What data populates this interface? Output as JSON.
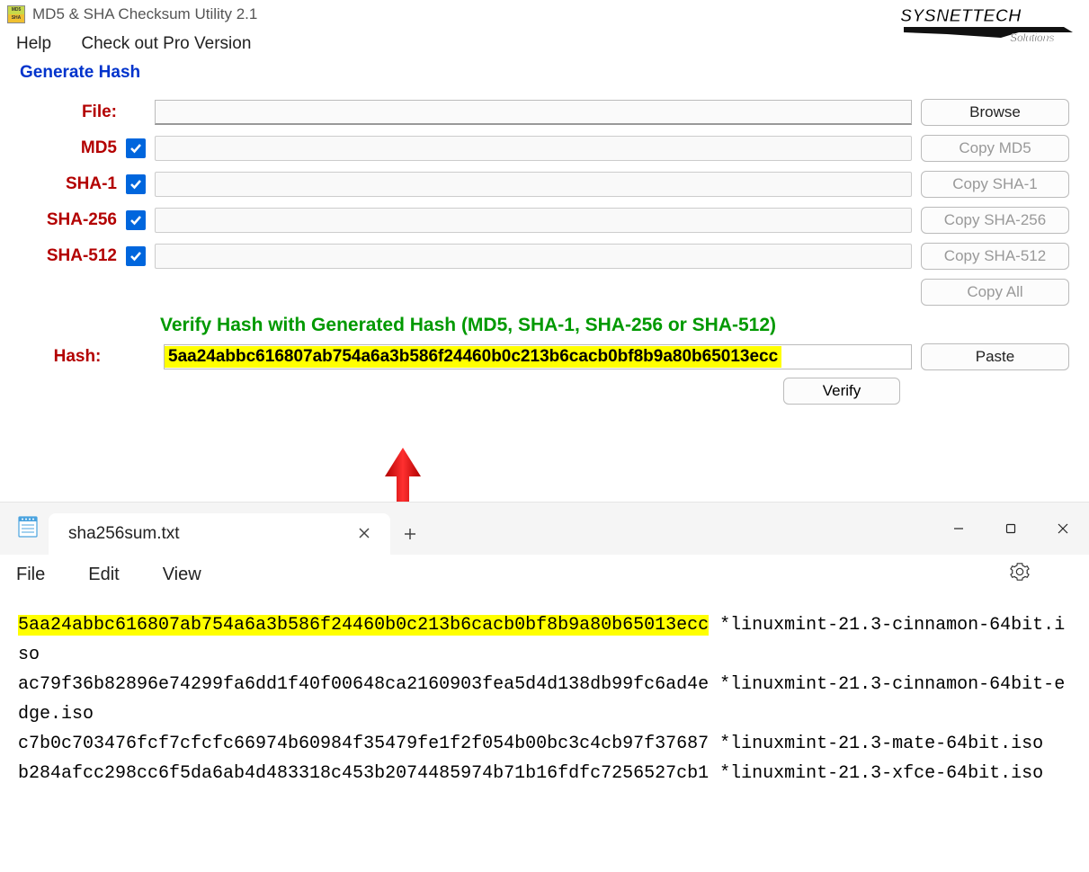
{
  "app": {
    "title": "MD5 & SHA Checksum Utility 2.1",
    "icon_top": "MD5",
    "icon_bot": "SHA"
  },
  "menu": {
    "help": "Help",
    "pro": "Check out Pro Version"
  },
  "section": {
    "generate": "Generate Hash"
  },
  "rows": {
    "file_label": "File:",
    "md5_label": "MD5",
    "sha1_label": "SHA-1",
    "sha256_label": "SHA-256",
    "sha512_label": "SHA-512"
  },
  "buttons": {
    "browse": "Browse",
    "copy_md5": "Copy MD5",
    "copy_sha1": "Copy SHA-1",
    "copy_sha256": "Copy SHA-256",
    "copy_sha512": "Copy SHA-512",
    "copy_all": "Copy All",
    "paste": "Paste",
    "verify": "Verify"
  },
  "verify": {
    "title": "Verify Hash with Generated Hash (MD5, SHA-1, SHA-256 or SHA-512)",
    "hash_label": "Hash:",
    "hash_value": "5aa24abbc616807ab754a6a3b586f24460b0c213b6cacb0bf8b9a80b65013ecc"
  },
  "logo": {
    "line1": "SYSNETTECH",
    "line2": "Solutions"
  },
  "notepad": {
    "tab_title": "sha256sum.txt",
    "menu": {
      "file": "File",
      "edit": "Edit",
      "view": "View"
    },
    "content": {
      "highlighted_hash": "5aa24abbc616807ab754a6a3b586f24460b0c213b6cacb0bf8b9a80b65013ecc",
      "line1_rest": " *linuxmint-21.3-cinnamon-64bit.iso",
      "line2": "ac79f36b82896e74299fa6dd1f40f00648ca2160903fea5d4d138db99fc6ad4e *linuxmint-21.3-cinnamon-64bit-edge.iso",
      "line3": "c7b0c703476fcf7cfcfc66974b60984f35479fe1f2f054b00bc3c4cb97f37687 *linuxmint-21.3-mate-64bit.iso",
      "line4": "b284afcc298cc6f5da6ab4d483318c453b2074485974b71b16fdfc7256527cb1 *linuxmint-21.3-xfce-64bit.iso"
    }
  }
}
